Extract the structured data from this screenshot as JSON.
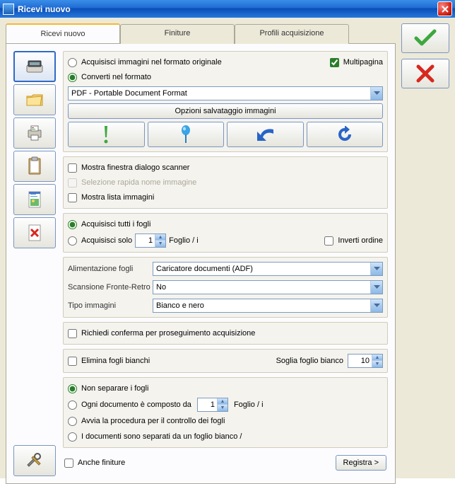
{
  "window": {
    "title": "Ricevi nuovo"
  },
  "tabs": {
    "t1": "Ricevi nuovo",
    "t2": "Finiture",
    "t3": "Profili acquisizione"
  },
  "fmt": {
    "acquire_original": "Acquisisci immagini nel formato originale",
    "convert": "Converti nel formato",
    "multipage": "Multipagina",
    "format_selected": "PDF - Portable Document Format",
    "save_options": "Opzioni salvataggio immagini"
  },
  "chk": {
    "show_scanner_dlg": "Mostra finestra dialogo scanner",
    "fast_name": "Selezione rapida nome immagine",
    "show_image_list": "Mostra lista immagini"
  },
  "sheets": {
    "all": "Acquisisci tutti i fogli",
    "only": "Acquisisci solo",
    "only_val": "1",
    "only_suffix": "Foglio / i",
    "invert": "Inverti ordine"
  },
  "dev": {
    "feed_label": "Alimentazione fogli",
    "feed_selected": "Caricatore documenti (ADF)",
    "duplex_label": "Scansione Fronte-Retro",
    "duplex_selected": "No",
    "type_label": "Tipo immagini",
    "type_selected": "Bianco e nero"
  },
  "confirm": {
    "label": "Richiedi conferma per proseguimento acquisizione"
  },
  "blank": {
    "remove": "Elimina fogli bianchi",
    "threshold_label": "Soglia foglio bianco",
    "threshold_val": "10"
  },
  "sep": {
    "none": "Non separare i fogli",
    "every": "Ogni documento è composto da",
    "every_val": "1",
    "every_suffix": "Foglio / i",
    "control": "Avvia la procedura per il controllo dei fogli",
    "white": "I documenti sono separati da un foglio bianco /"
  },
  "footer": {
    "also_finish": "Anche finiture",
    "register": "Registra >"
  }
}
